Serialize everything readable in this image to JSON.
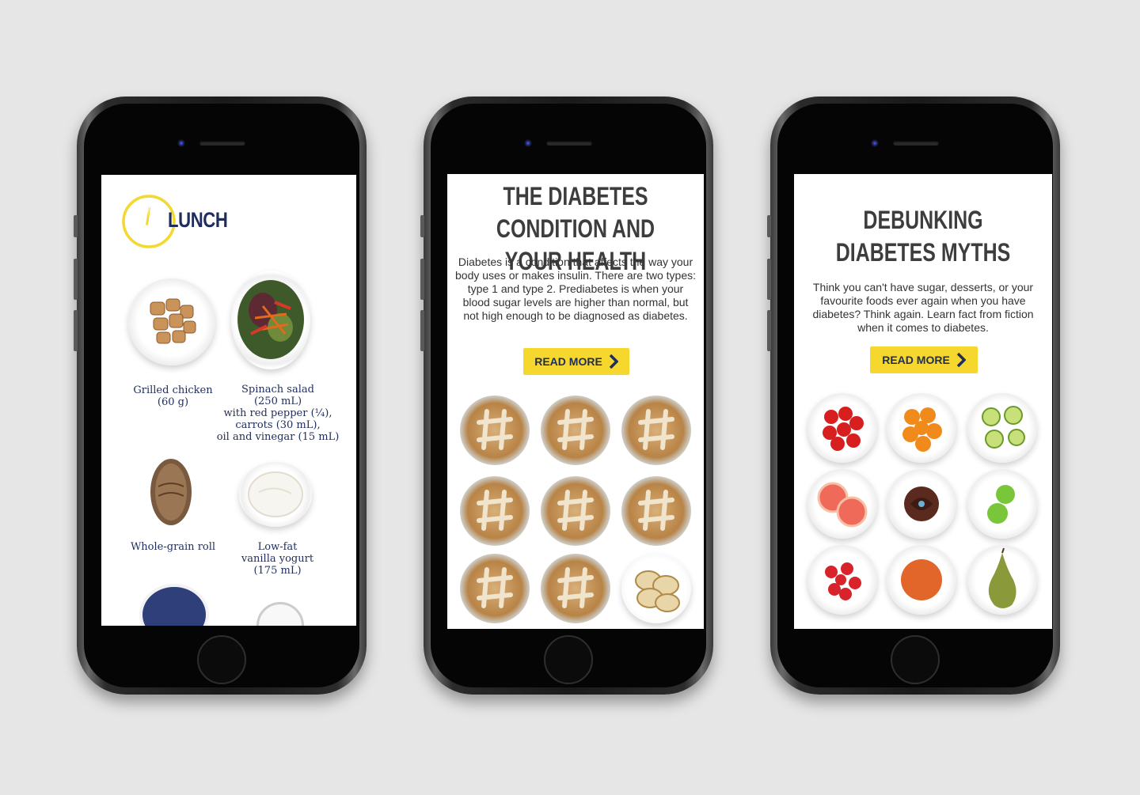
{
  "phone1": {
    "title": "LUNCH",
    "foods": [
      {
        "label": "Grilled chicken\n(60 g)"
      },
      {
        "label": "Spinach salad\n(250 mL)\nwith red pepper (¼),\ncarrots (30 mL),\noil and vinegar (15 mL)"
      },
      {
        "label": "Whole-grain roll"
      },
      {
        "label": "Low-fat\nvanilla yogurt\n(175 mL)"
      }
    ]
  },
  "phone2": {
    "headline": "THE DIABETES CONDITION AND YOUR HEALTH",
    "body": "Diabetes is a condition that affects the way your body uses or makes insulin. There are two types: type 1 and type 2. Prediabetes is when your blood sugar levels are higher than normal, but not high enough to be diagnosed as diabetes.",
    "button_label": "READ MORE"
  },
  "phone3": {
    "headline": "DEBUNKING DIABETES MYTHS",
    "body": "Think you can't have sugar, desserts, or your favourite foods ever again when you have diabetes? Think again. Learn fact from fiction when it comes to diabetes.",
    "button_label": "READ MORE"
  },
  "colors": {
    "navy": "#1e2d5c",
    "yellow": "#f6d72e",
    "headline_gray": "#3d3d3d"
  }
}
